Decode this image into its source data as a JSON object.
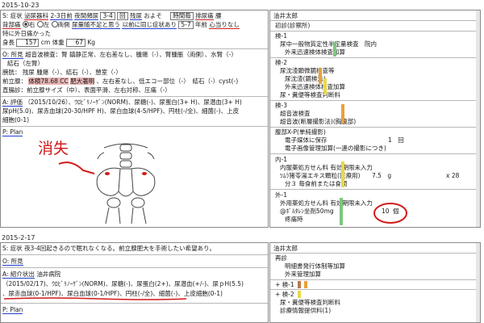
{
  "record1": {
    "date": "2015-10-23",
    "soap_s": {
      "label": "S: 症状",
      "chip1": "泌尿器科",
      "chip2": "2-3日前",
      "chip3": "夜間頻尿",
      "chip4": "3-4",
      "chip5": "回",
      "chip6": "残尿",
      "chip7": "およそ",
      "chip8": "時間毎",
      "chip9": "排尿痛",
      "chip10": "腰",
      "row2_a": "背部痛",
      "row2_right": "右",
      "row2_left": "左",
      "row2_both": "両側",
      "row2_b": "尿量随不足と思う",
      "row2_c": "以前に同じ症状あり",
      "row2_d": "5-7",
      "row2_e": "年前",
      "row2_f": "心当りなし",
      "row3": "特に外日痛かった",
      "height_label": "身長",
      "height_val": "157",
      "height_unit": "cm",
      "weight_label": "体重",
      "weight_val": "67",
      "weight_unit": "Kg"
    },
    "soap_o": {
      "label": "O: 所見",
      "line1": "超音波検査：腎 鎮静正常、左右差なし、腫瘍（-）、腎腫脹（両側）、水腎（-）",
      "line2": "結石（左腎）",
      "line3": "膀胱： 残尿 腫瘍（-）、結石（-）、憩室（-）",
      "line4_a": "前立腺：",
      "line4_b": "体積78.68 CC",
      "line4_c": "肥大著明",
      "line4_d": "、左右差なし、低エコー部位（-）　結石（-）cyst(-)",
      "line5": "直腸診：前立腺サイズ（中）、表面平滑、左右対称、圧痛（-）"
    },
    "soap_a": {
      "label": "A: 評価",
      "line1": "（2015/10/26）、ｳﾛﾋﾞﾘﾉｰｹﾞﾝ(NORM)、尿糖(-)、尿蛋白(3+ H)、尿潜血(3+ H)",
      "line2": "尿pH(5.0)、尿赤血球(20-30/HPF H)、尿白血球(4-5/HPF)、円柱(-/全)、細菌(-)、上皮",
      "line3": "細胞(0-1)"
    },
    "soap_p": {
      "label": "P: Plan"
    },
    "annotation": "消失",
    "orders": {
      "patient": "油井太郎",
      "section0": "初診(診察所)",
      "g1_title": "検-1",
      "g1_items": [
        "尿中一般物質定性半定量検査　院内",
        "外来迅速検体検査加算"
      ],
      "g2_title": "検-2",
      "g2_items": [
        "尿沈渣顕微鏡検査等",
        "尿沈渣(鏡検法)",
        "外来迅速検体検査加算",
        "尿・糞便等検査判断料"
      ],
      "g3_title": "検-3",
      "g3_items": [
        "超音波検査",
        "超音波(断層撮影法)(胸腹部)"
      ],
      "g4_title": "腹部X-P(単純撮影)",
      "g4_items": [
        "電子媒体に保存",
        "電子画像管理加算(一連の撮影につき)"
      ],
      "g4_qty": "1　回",
      "g5_title": "内-1",
      "g5_items": [
        "内服薬処方せん料 有効期限未入力",
        "ﾂﾑﾗ猪苓湯エキス顆粒(医療用)",
        "分３ 毎食前または食間"
      ],
      "g5_qty": "7.5　g",
      "g5_days": "x 28",
      "g6_title": "外-1",
      "g6_items": [
        "外用薬処方せん料 有効期限未入力",
        "@ﾎﾞﾙﾀﾚﾝ坐剤50mg",
        "疼痛時"
      ],
      "g6_qty": "10",
      "g6_unit": "個"
    }
  },
  "record2": {
    "date": "2015-2-17",
    "soap_s": {
      "label": "S: 症状",
      "text": "夜3-4回起きるので眠れなくなる。前立腺肥大を手術したい希望あり。"
    },
    "soap_o": {
      "label": "O: 所見"
    },
    "soap_a": {
      "label": "A: 紹介状出",
      "hospital": "油井病院",
      "line1": "（2015/02/17)、ｳﾛﾋﾞﾘﾉｰｹﾞﾝ(NORM)、尿糖(-)、尿蛋白(2+)、尿潜血(+/-)、尿ｐH(5.5)",
      "line2": "、尿赤血球(0-1/HPF)、尿白血球(0-1/HPF)、円柱(-/全)、細菌(-)、上皮細胞(0-1)"
    },
    "soap_p": {
      "label": "P: Plan"
    },
    "orders": {
      "patient": "油井太郎",
      "section0": "再診",
      "items0": [
        "明細書発行体制等加算",
        "外来管理加算"
      ],
      "g1_title": "検-1",
      "g2_title": "検-2",
      "g2_items": [
        "尿・糞便等検査判断料",
        "診療情報提供料(1)"
      ]
    }
  },
  "colors": {
    "bar_green": "#7dc77d",
    "bar_orange": "#e8a23a",
    "bar_yellow": "#e9d84a",
    "bar_red": "#d9533d",
    "bar_brown": "#b87a4b",
    "annotation_red": "#d21a1a"
  }
}
